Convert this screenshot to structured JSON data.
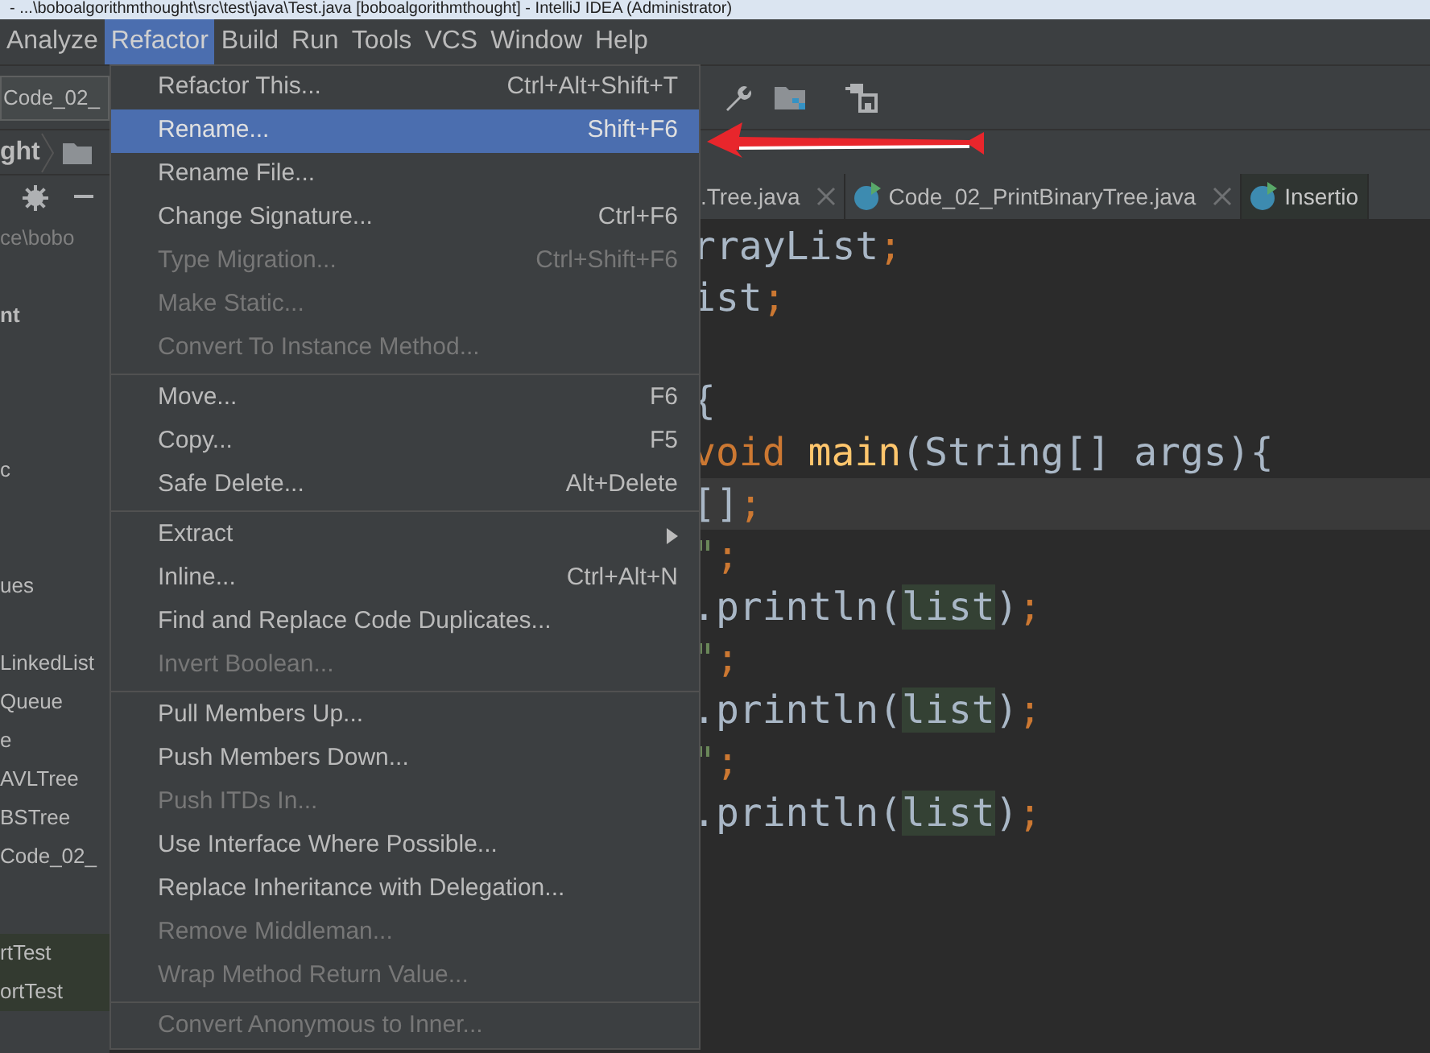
{
  "window": {
    "title": "- ...\\boboalgorithmthought\\src\\test\\java\\Test.java [boboalgorithmthought] - IntelliJ IDEA (Administrator)"
  },
  "menu_bar": [
    {
      "label": "Analyze",
      "selected": false
    },
    {
      "label": "Refactor",
      "selected": true
    },
    {
      "label": "Build",
      "selected": false
    },
    {
      "label": "Run",
      "selected": false
    },
    {
      "label": "Tools",
      "selected": false
    },
    {
      "label": "VCS",
      "selected": false
    },
    {
      "label": "Window",
      "selected": false
    },
    {
      "label": "Help",
      "selected": false
    }
  ],
  "toolbar": {
    "config_selector": "Code_02_"
  },
  "breadcrumb": {
    "label": "ght"
  },
  "project_panel": {
    "items": [
      {
        "label": "ce\\bobo",
        "kind": "path"
      },
      {
        "label": "nt",
        "kind": "module"
      },
      {
        "label": "c",
        "kind": "file"
      },
      {
        "label": "ues",
        "kind": "file"
      },
      {
        "label": "LinkedList",
        "kind": "file"
      },
      {
        "label": "Queue",
        "kind": "file"
      },
      {
        "label": "e",
        "kind": "file"
      },
      {
        "label": "AVLTree",
        "kind": "file"
      },
      {
        "label": "BSTree",
        "kind": "file"
      },
      {
        "label": "Code_02_",
        "kind": "file"
      },
      {
        "label": "rtTest",
        "kind": "test"
      },
      {
        "label": "ortTest",
        "kind": "test"
      }
    ]
  },
  "editor_tabs": [
    {
      "label": ".Tree.java",
      "selected": false,
      "icon": false
    },
    {
      "label": "Code_02_PrintBinaryTree.java",
      "selected": false,
      "icon": true
    },
    {
      "label": "Insertio",
      "selected": true,
      "icon": true
    }
  ],
  "code_lines": [
    {
      "current": false,
      "segments": [
        {
          "text": "rrayList",
          "kind": "plain"
        },
        {
          "text": ";",
          "kind": "punct"
        }
      ]
    },
    {
      "current": false,
      "segments": [
        {
          "text": "ist",
          "kind": "plain"
        },
        {
          "text": ";",
          "kind": "punct"
        }
      ]
    },
    {
      "current": false,
      "segments": [
        {
          "text": "{",
          "kind": "plain"
        }
      ]
    },
    {
      "current": false,
      "segments": [
        {
          "text": "void",
          "kind": "keyword"
        },
        {
          "text": "main",
          "kind": "method"
        },
        {
          "text": "(String[] args){",
          "kind": "plain"
        }
      ]
    },
    {
      "current": true,
      "segments": [
        {
          "text": "[]",
          "kind": "plain"
        },
        {
          "text": ";",
          "kind": "punct"
        }
      ]
    },
    {
      "current": false,
      "segments": [
        {
          "text": "\"",
          "kind": "string"
        },
        {
          "text": ";",
          "kind": "punct"
        }
      ]
    },
    {
      "current": false,
      "segments": [
        {
          "text": ".println(",
          "kind": "plain"
        },
        {
          "text": "list",
          "kind": "match"
        },
        {
          "text": ")",
          "kind": "plain"
        },
        {
          "text": ";",
          "kind": "punct"
        }
      ]
    },
    {
      "current": false,
      "segments": [
        {
          "text": "\"",
          "kind": "string"
        },
        {
          "text": ";",
          "kind": "punct"
        }
      ]
    },
    {
      "current": false,
      "segments": [
        {
          "text": ".println(",
          "kind": "plain"
        },
        {
          "text": "list",
          "kind": "match"
        },
        {
          "text": ")",
          "kind": "plain"
        },
        {
          "text": ";",
          "kind": "punct"
        }
      ]
    },
    {
      "current": false,
      "segments": [
        {
          "text": "\"",
          "kind": "string"
        },
        {
          "text": ";",
          "kind": "punct"
        }
      ]
    },
    {
      "current": false,
      "segments": [
        {
          "text": ".println(",
          "kind": "plain"
        },
        {
          "text": "list",
          "kind": "match"
        },
        {
          "text": ")",
          "kind": "plain"
        },
        {
          "text": ";",
          "kind": "punct"
        }
      ]
    }
  ],
  "refactor_menu": [
    {
      "kind": "item",
      "label": "Refactor This...",
      "shortcut": "Ctrl+Alt+Shift+T",
      "disabled": false,
      "selected": false
    },
    {
      "kind": "item",
      "label": "Rename...",
      "shortcut": "Shift+F6",
      "disabled": false,
      "selected": true
    },
    {
      "kind": "item",
      "label": "Rename File...",
      "disabled": false,
      "selected": false
    },
    {
      "kind": "item",
      "label": "Change Signature...",
      "shortcut": "Ctrl+F6",
      "disabled": false,
      "selected": false
    },
    {
      "kind": "item",
      "label": "Type Migration...",
      "shortcut": "Ctrl+Shift+F6",
      "disabled": true,
      "selected": false
    },
    {
      "kind": "item",
      "label": "Make Static...",
      "disabled": true,
      "selected": false
    },
    {
      "kind": "item",
      "label": "Convert To Instance Method...",
      "disabled": true,
      "selected": false
    },
    {
      "kind": "separator"
    },
    {
      "kind": "item",
      "label": "Move...",
      "shortcut": "F6",
      "disabled": false,
      "selected": false
    },
    {
      "kind": "item",
      "label": "Copy...",
      "shortcut": "F5",
      "disabled": false,
      "selected": false
    },
    {
      "kind": "item",
      "label": "Safe Delete...",
      "shortcut": "Alt+Delete",
      "disabled": false,
      "selected": false
    },
    {
      "kind": "separator"
    },
    {
      "kind": "submenu",
      "label": "Extract",
      "disabled": false,
      "selected": false
    },
    {
      "kind": "item",
      "label": "Inline...",
      "shortcut": "Ctrl+Alt+N",
      "disabled": false,
      "selected": false
    },
    {
      "kind": "item",
      "label": "Find and Replace Code Duplicates...",
      "disabled": false,
      "selected": false
    },
    {
      "kind": "item",
      "label": "Invert Boolean...",
      "disabled": true,
      "selected": false
    },
    {
      "kind": "separator"
    },
    {
      "kind": "item",
      "label": "Pull Members Up...",
      "disabled": false,
      "selected": false
    },
    {
      "kind": "item",
      "label": "Push Members Down...",
      "disabled": false,
      "selected": false
    },
    {
      "kind": "item",
      "label": "Push ITDs In...",
      "disabled": true,
      "selected": false
    },
    {
      "kind": "item",
      "label": "Use Interface Where Possible...",
      "disabled": false,
      "selected": false
    },
    {
      "kind": "item",
      "label": "Replace Inheritance with Delegation...",
      "disabled": false,
      "selected": false
    },
    {
      "kind": "item",
      "label": "Remove Middleman...",
      "disabled": true,
      "selected": false
    },
    {
      "kind": "item",
      "label": "Wrap Method Return Value...",
      "disabled": true,
      "selected": false
    },
    {
      "kind": "separator"
    },
    {
      "kind": "item",
      "label": "Convert Anonymous to Inner...",
      "disabled": true,
      "selected": false
    }
  ]
}
